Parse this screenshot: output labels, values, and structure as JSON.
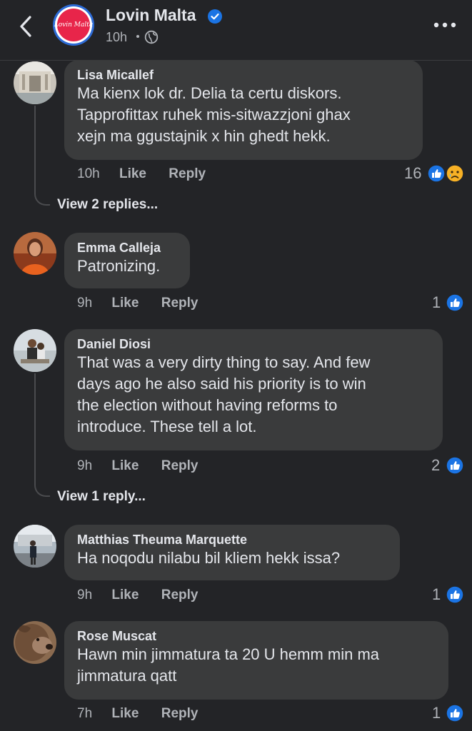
{
  "header": {
    "page_name": "Lovin Malta",
    "logo_text": "Lovin Malta",
    "post_time": "10h",
    "icons": [
      "back-arrow-icon",
      "verified-badge-icon",
      "globe-icon",
      "more-options-icon"
    ]
  },
  "comments": [
    {
      "author": "Lisa Micallef",
      "lines": [
        "Ma kienx lok dr. Delia ta certu diskors.",
        "Tapprofittax ruhek mis-sitwazzjoni ghax",
        "xejn ma ggustajnik x hin ghedt hekk."
      ],
      "time": "10h",
      "like": "Like",
      "reply": "Reply",
      "reactions": "16",
      "reaction_icons": [
        "like-reaction-icon",
        "sad-reaction-icon"
      ],
      "view_replies": "View 2 replies..."
    },
    {
      "author": "Emma Calleja",
      "lines": [
        "Patronizing."
      ],
      "time": "9h",
      "like": "Like",
      "reply": "Reply",
      "reactions": "1",
      "reaction_icons": [
        "like-reaction-icon"
      ]
    },
    {
      "author": "Daniel Diosi",
      "lines": [
        "That was a very dirty thing to say. And few",
        "days ago he also said his priority is to win",
        "the election without having reforms to",
        "introduce. These tell a lot."
      ],
      "time": "9h",
      "like": "Like",
      "reply": "Reply",
      "reactions": "2",
      "reaction_icons": [
        "like-reaction-icon"
      ],
      "view_replies": "View 1 reply..."
    },
    {
      "author": "Matthias Theuma Marquette",
      "lines": [
        "Ha noqodu nilabu bil kliem hekk issa?"
      ],
      "time": "9h",
      "like": "Like",
      "reply": "Reply",
      "reactions": "1",
      "reaction_icons": [
        "like-reaction-icon"
      ]
    },
    {
      "author": "Rose Muscat",
      "lines": [
        "Hawn min jimmatura ta 20 U hemm min ma",
        "jimmatura qatt"
      ],
      "time": "7h",
      "like": "Like",
      "reply": "Reply",
      "reactions": "1",
      "reaction_icons": [
        "like-reaction-icon"
      ]
    }
  ],
  "colors": {
    "background": "#232427",
    "bubble": "#3a3b3c",
    "text": "#e4e6eb",
    "secondary_text": "#b0b3b8",
    "facebook_blue": "#1b74e4",
    "brand_red": "#e8254a"
  }
}
